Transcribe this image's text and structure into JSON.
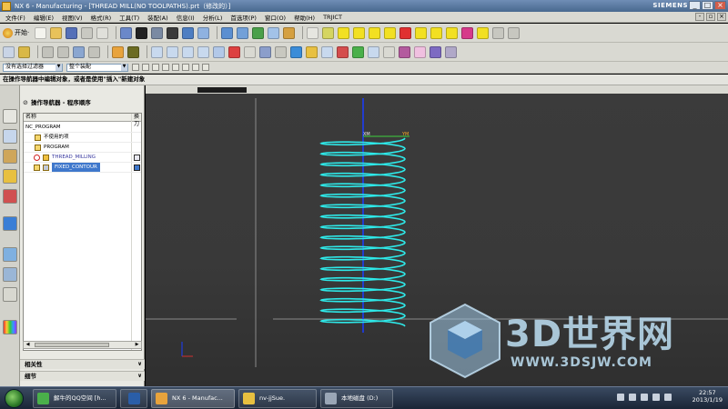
{
  "window": {
    "title": "NX 6 - Manufacturing - [THREAD MILL(NO TOOLPATHS).prt（修改的）]",
    "brand": "SIEMENS",
    "controls": [
      "_",
      "□",
      "×"
    ]
  },
  "menubar": {
    "items": [
      "文件(F)",
      "编辑(E)",
      "视图(V)",
      "格式(R)",
      "工具(T)",
      "装配(A)",
      "信息(I)",
      "分析(L)",
      "首选项(P)",
      "窗口(O)",
      "帮助(H)",
      "TRJICT"
    ]
  },
  "toolbar": {
    "start_label": "开始·",
    "selection_filter": "没有选择过滤器",
    "assembly_scope": "整个装配"
  },
  "status_line": "在操作导航器中编辑对象，或者是使用\"插入\"新建对象",
  "navigator": {
    "title": "操作导航器 - 程序顺序",
    "columns": {
      "name": "名称",
      "change": "换刀"
    },
    "rows": [
      {
        "label": "NC_PROGRAM",
        "indent": 0,
        "icon": "program-root"
      },
      {
        "label": "不使用的项",
        "indent": 1,
        "icon": "folder"
      },
      {
        "label": "PROGRAM",
        "indent": 1,
        "icon": "folder"
      },
      {
        "label": "THREAD_MILLING",
        "indent": 2,
        "icon": "thread-mill-op"
      },
      {
        "label": "FIXED_CONTOUR",
        "indent": 2,
        "icon": "contour-op",
        "selected": true
      }
    ],
    "sections": [
      "相关性",
      "细节"
    ]
  },
  "viewport": {
    "axis_labels": {
      "xm": "XM",
      "ym": "YM"
    },
    "helix_color": "#2ee8e8",
    "axis_color": "#1a3cff",
    "ym_color": "#f5a623"
  },
  "watermark": {
    "title": "3D世界网",
    "url": "WWW.3DSJW.COM"
  },
  "taskbar": {
    "tasks": [
      {
        "label": "解牛的QQ空间 [h..."
      },
      {
        "label": ""
      },
      {
        "label": "NX 6 - Manufac..."
      },
      {
        "label": "nv-jjSue."
      },
      {
        "label": "本地磁盘 (D:)"
      }
    ],
    "clock": {
      "time": "22:57",
      "date": "2013/1/19"
    }
  }
}
